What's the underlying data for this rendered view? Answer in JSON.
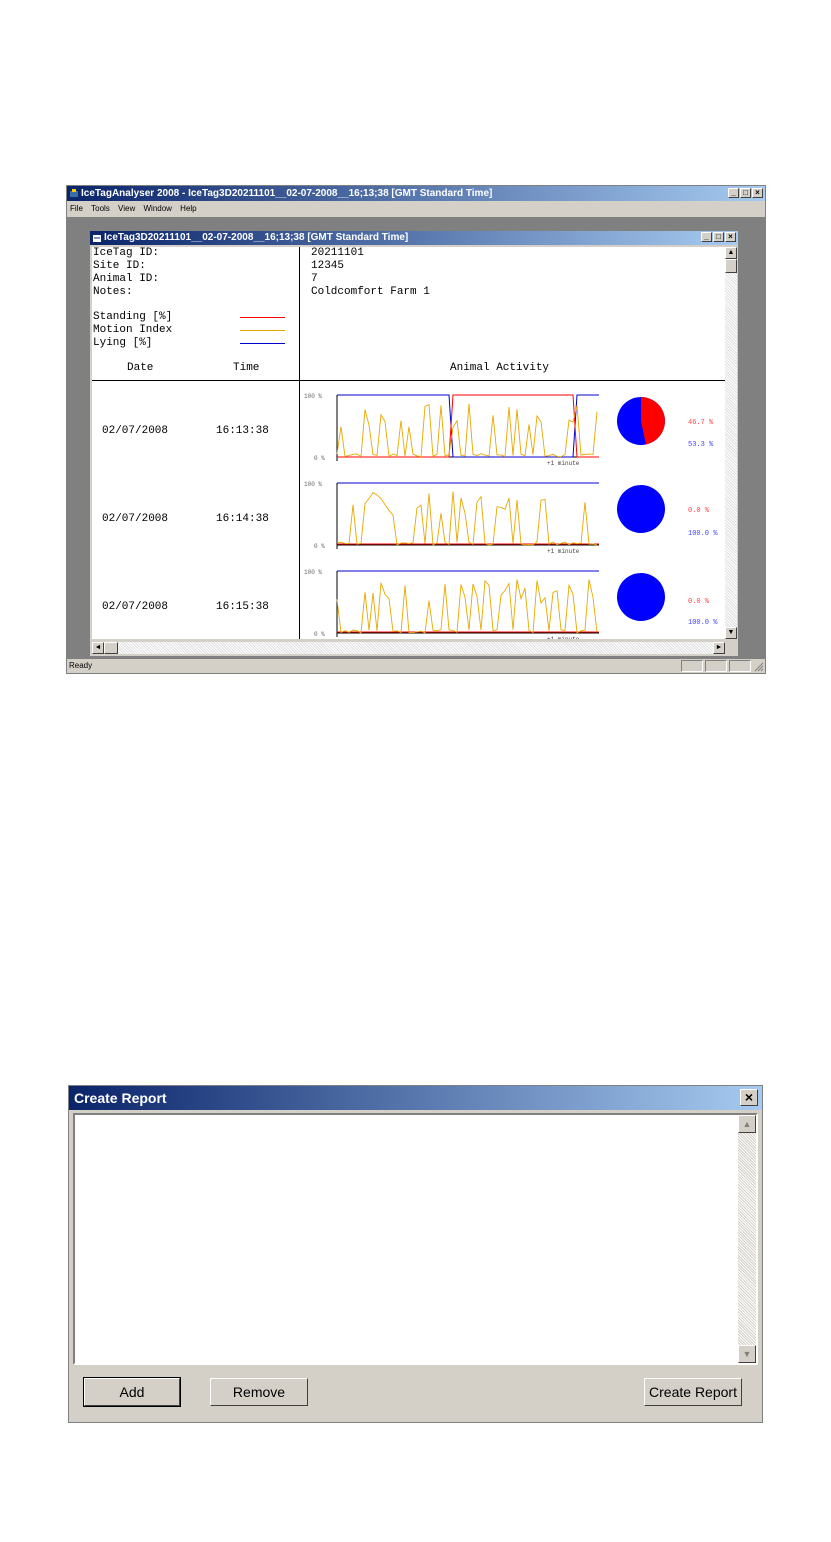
{
  "app": {
    "title": "IceTagAnalyser 2008 - IceTag3D20211101__02-07-2008__16;13;38 [GMT Standard Time]",
    "menu": [
      "File",
      "Tools",
      "View",
      "Window",
      "Help"
    ],
    "status": "Ready"
  },
  "child": {
    "title": "IceTag3D20211101__02-07-2008__16;13;38 [GMT Standard Time]"
  },
  "report": {
    "labels": {
      "icetag_id": "IceTag ID:",
      "site_id": "Site ID:",
      "animal_id": "Animal ID:",
      "notes": "Notes:"
    },
    "values": {
      "icetag_id": "20211101",
      "site_id": "12345",
      "animal_id": "7",
      "notes": "Coldcomfort Farm 1"
    },
    "legend": [
      {
        "label": "Standing [%]",
        "color": "#ff0000"
      },
      {
        "label": "Motion Index",
        "color": "#e8a800"
      },
      {
        "label": "Lying [%]",
        "color": "#0000cc"
      }
    ],
    "columns": {
      "date": "Date",
      "time": "Time",
      "activity": "Animal Activity"
    },
    "axis": {
      "top": "100 %",
      "bottom": "0 %",
      "x_note": "+1 minute"
    },
    "rows": [
      {
        "date": "02/07/2008",
        "time": "16:13:38",
        "standing_pct": "46.7 %",
        "lying_pct": "53.3 %",
        "standing": 46.7
      },
      {
        "date": "02/07/2008",
        "time": "16:14:38",
        "standing_pct": "0.0 %",
        "lying_pct": "100.0 %",
        "standing": 0
      },
      {
        "date": "02/07/2008",
        "time": "16:15:38",
        "standing_pct": "0.0 %",
        "lying_pct": "100.0 %",
        "standing": 0
      }
    ]
  },
  "dialog": {
    "title": "Create Report",
    "buttons": {
      "add": "Add",
      "remove": "Remove",
      "create": "Create Report"
    }
  }
}
